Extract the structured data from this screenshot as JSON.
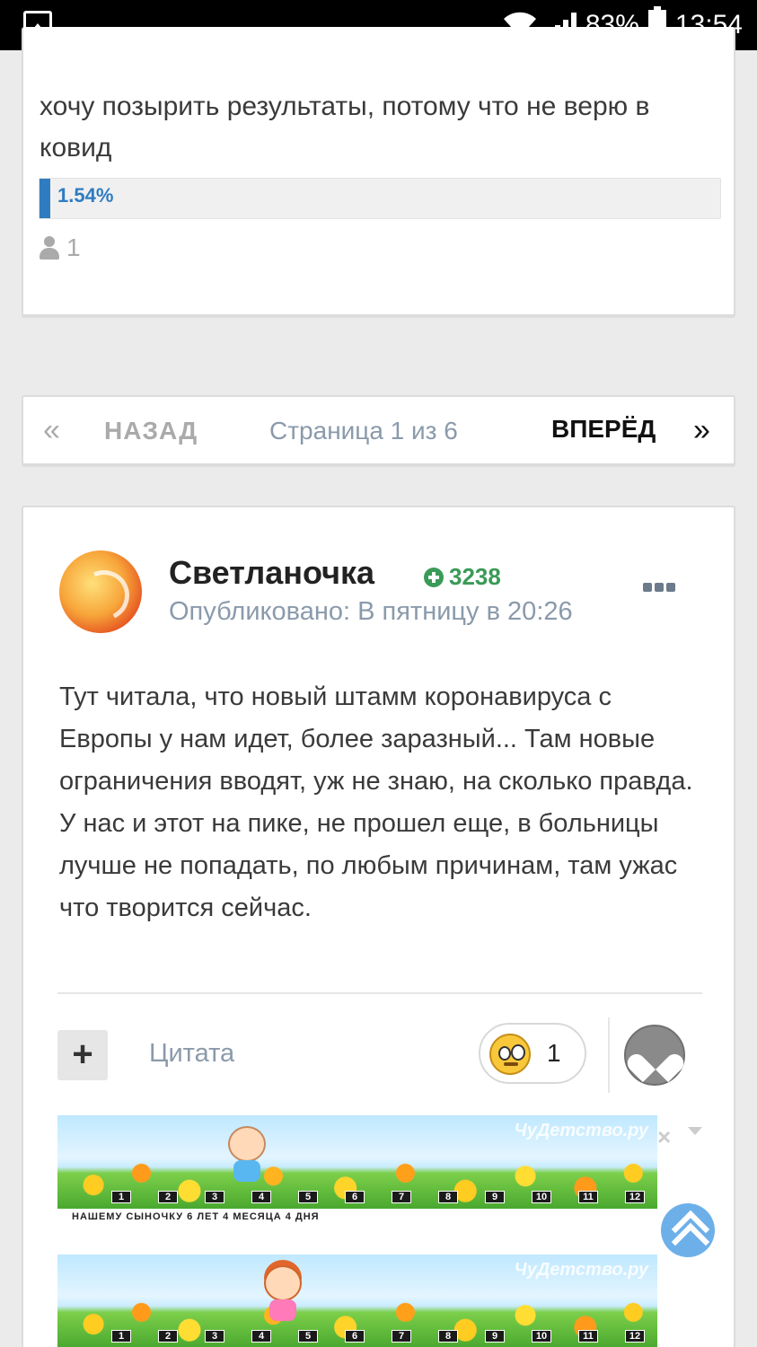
{
  "status_bar": {
    "battery": "83%",
    "time": "13:54"
  },
  "poll": {
    "question": "хочу позырить результаты, потому что не верю в ковид",
    "percent_label": "1.54%",
    "percent_value": 1.54,
    "voters": "1"
  },
  "pagination": {
    "prev_arrow": "«",
    "prev_label": "НАЗАД",
    "page_label": "Страница 1 из 6",
    "next_label": "ВПЕРЁД",
    "next_arrow": "»"
  },
  "post": {
    "author": "Светланочка",
    "reputation": "3238",
    "posted": "Опубликовано: В пятницу в 20:26",
    "body": "Тут читала, что новый штамм коронавируса с Европы у нам идет, более заразный... Там новые ограничения вводят, уж не знаю, на сколько правда. У нас и этот на пике, не прошел еще, в больницы лучше не попадать, по любым причинам, там ужас  что творится сейчас.",
    "add_button": "+",
    "quote_label": "Цитата",
    "reaction_count": "1"
  },
  "signature": {
    "watermark": "ЧуДетство.ру",
    "scale": [
      "1",
      "2",
      "3",
      "4",
      "5",
      "6",
      "7",
      "8",
      "9",
      "10",
      "11",
      "12"
    ],
    "caption": "НАШЕМУ СЫНОЧКУ  6 ЛЕТ 4 МЕСЯЦА 4 ДНЯ",
    "close_icon": "×"
  },
  "colors": {
    "accent": "#2f7cc1",
    "reputation": "#3a9a57",
    "muted_text": "#8a9aab"
  }
}
